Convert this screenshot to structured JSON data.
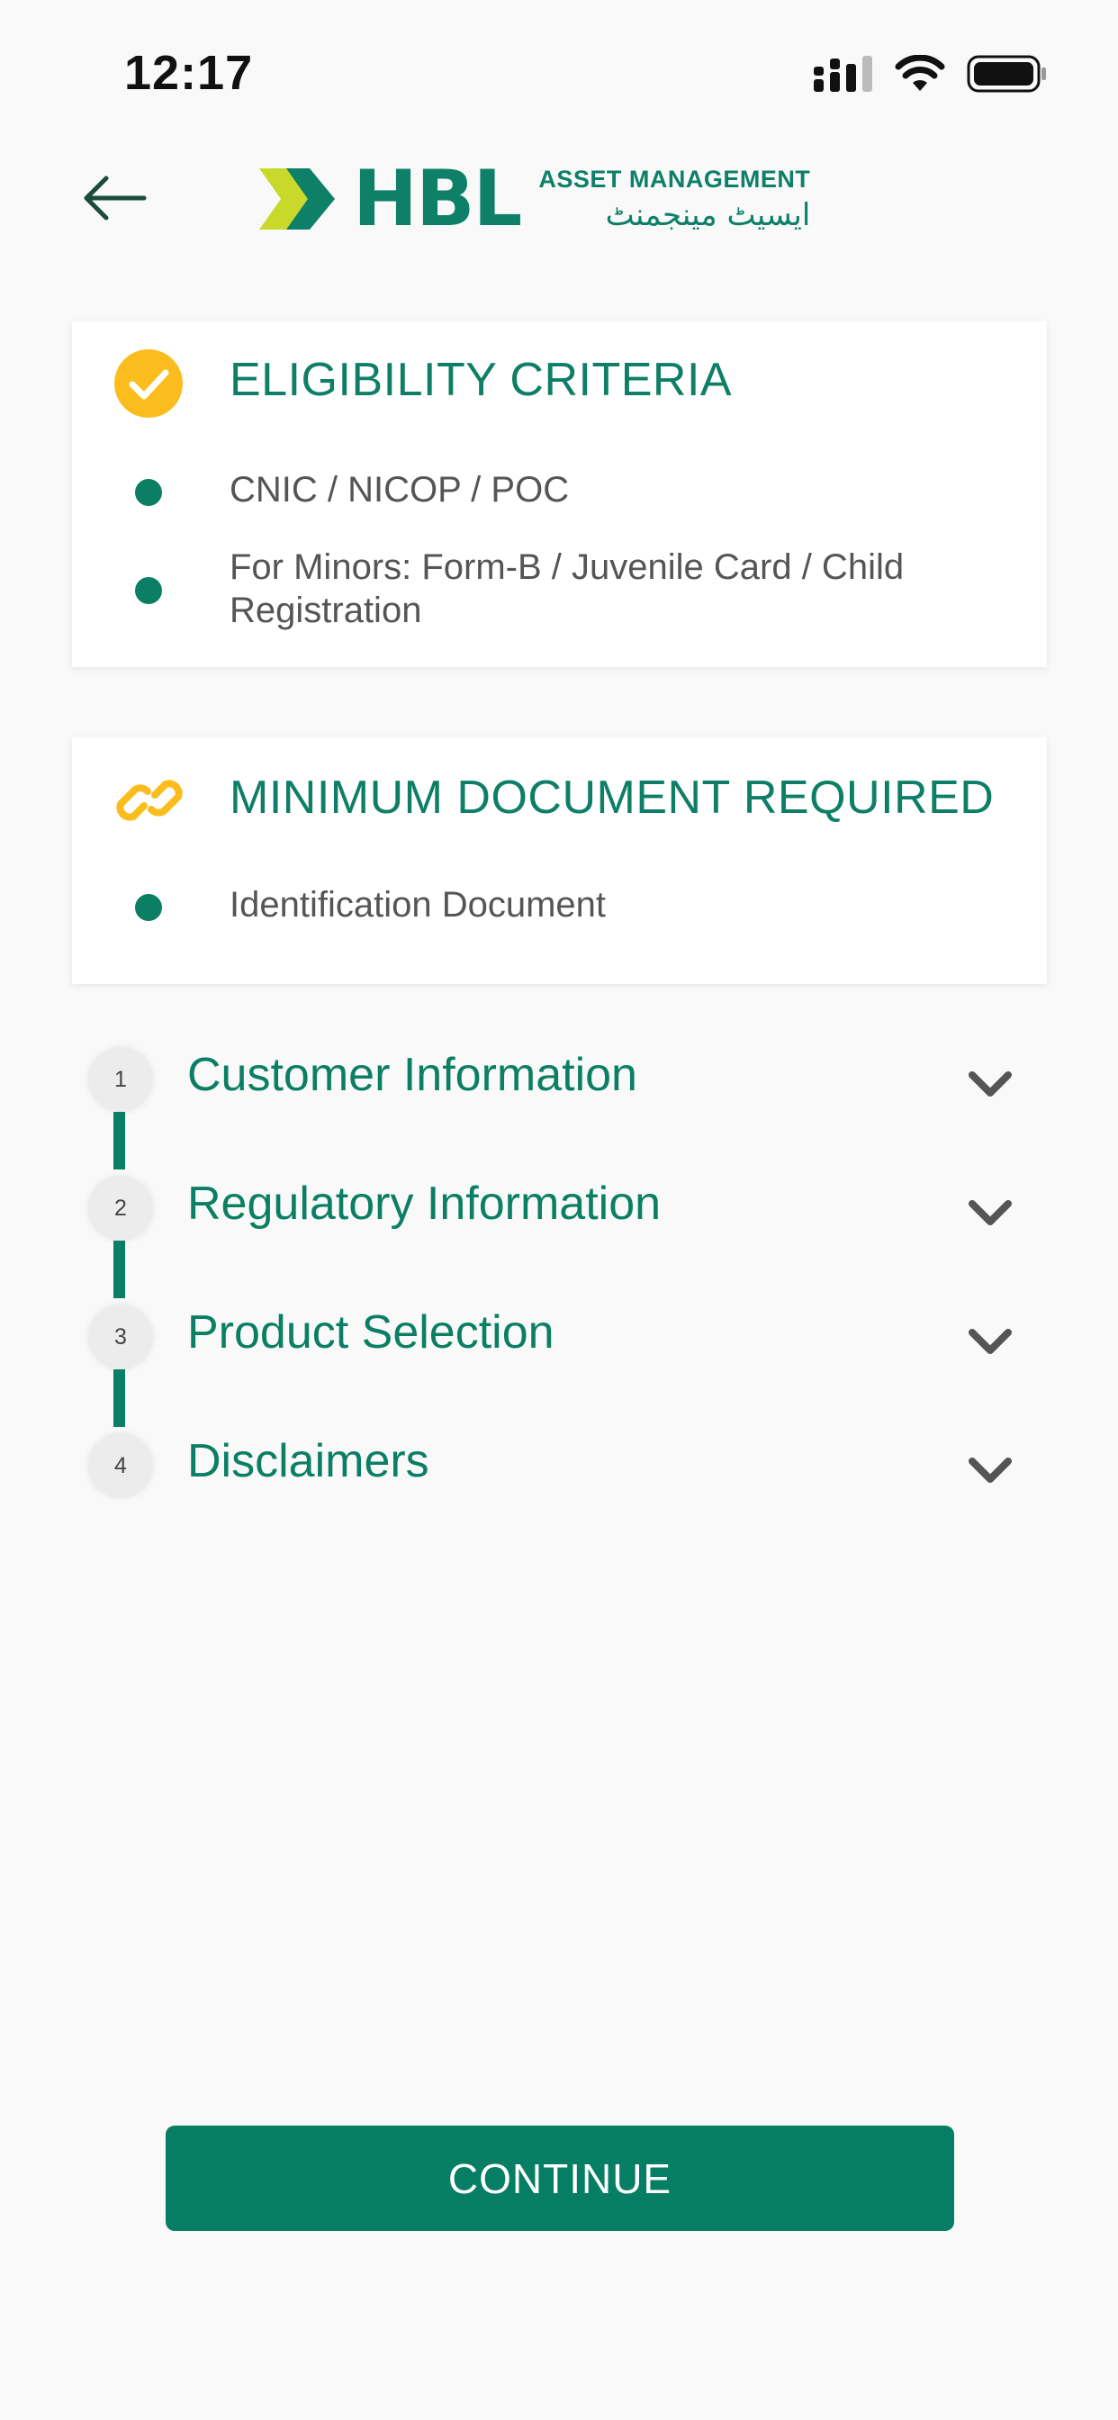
{
  "status_bar": {
    "time": "12:17"
  },
  "header": {
    "logo_mark": "HBL",
    "logo_subtitle": "ASSET MANAGEMENT",
    "logo_urdu": "ایسیٹ مینجمنٹ"
  },
  "eligibility": {
    "title": "ELIGIBILITY CRITERIA",
    "items": [
      "CNIC / NICOP / POC",
      "For Minors: Form-B / Juvenile Card / Child Registration"
    ]
  },
  "documents": {
    "title": "MINIMUM DOCUMENT REQUIRED",
    "items": [
      "Identification Document"
    ]
  },
  "steps": [
    {
      "number": "1",
      "label": "Customer Information"
    },
    {
      "number": "2",
      "label": "Regulatory Information"
    },
    {
      "number": "3",
      "label": "Product Selection"
    },
    {
      "number": "4",
      "label": "Disclaimers"
    }
  ],
  "continue_label": "CONTINUE",
  "colors": {
    "brand_green": "#0b7f63",
    "accent_yellow": "#fbbd1e",
    "logo_lime": "#c8d92b"
  }
}
